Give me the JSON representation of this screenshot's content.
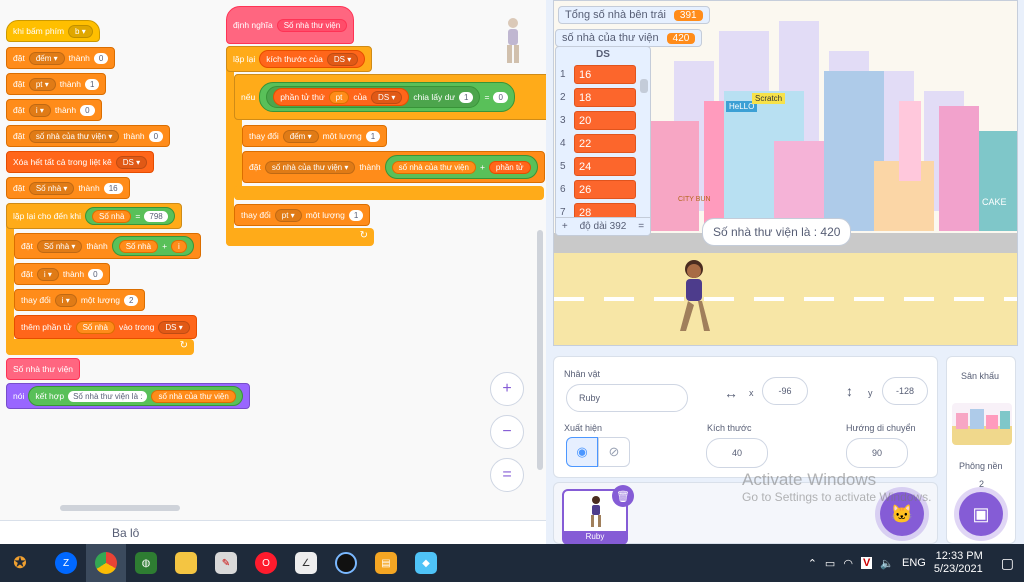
{
  "script_left": {
    "when_key": "khi bấm phím",
    "when_key_val": "b",
    "set1_label": "đặt",
    "set1_var": "đếm",
    "set1_to": "thành",
    "set1_val": "0",
    "set2_label": "đặt",
    "set2_var": "pt",
    "set2_to": "thành",
    "set2_val": "1",
    "set3_label": "đặt",
    "set3_var": "i",
    "set3_to": "thành",
    "set3_val": "0",
    "set4_label": "đặt",
    "set4_var": "số nhà của thư viện",
    "set4_to": "thành",
    "set4_val": "0",
    "clear_label": "Xóa hết tất cả trong liệt kê",
    "clear_list": "DS",
    "set5_label": "đặt",
    "set5_var": "Số nhà",
    "set5_to": "thành",
    "set5_val": "16",
    "repeat_label": "lặp lại cho đến khi",
    "repeat_var": "Số nhà",
    "repeat_op": "=",
    "repeat_val": "798",
    "set6_label": "đặt",
    "set6_var": "Số nhà",
    "set6_to": "thành",
    "set6_rep": "Số nhà",
    "set6_plus": "+",
    "set6_rep2": "i",
    "set7_label": "đặt",
    "set7_var": "i",
    "set7_to": "thành",
    "set7_val": "0",
    "change_label": "thay đổi",
    "change_var": "i",
    "change_by": "một lượng",
    "change_val": "2",
    "add_label": "thêm phần tử",
    "add_rep": "Số nhà",
    "add_into": "vào trong",
    "add_list": "DS",
    "call_label": "Số nhà thư viện",
    "say_label": "nói",
    "join_label": "kết hợp",
    "join_txt": "Số nhà thư viện là  :",
    "join_rep": "số nhà của thư viện"
  },
  "script_right": {
    "define_label": "định nghĩa",
    "define_name": "Số nhà thư viện",
    "repeat_label": "lặp lại",
    "repeat_op": "kích thước của",
    "repeat_list": "DS",
    "if_label": "nếu",
    "if_item": "phần tử thứ",
    "if_rep": "pt",
    "if_of": "của",
    "if_list": "DS",
    "if_mod": "chia lấy dư",
    "if_modval": "1",
    "if_eq": "=",
    "if_val": "0",
    "change1_label": "thay đổi",
    "change1_var": "đếm",
    "change1_by": "một lượng",
    "change1_val": "1",
    "set_label": "đặt",
    "set_var": "số nhà của thư viện",
    "set_to": "thành",
    "set_rep": "số nhà của thư viện",
    "set_plus": "+",
    "set_item": "phần tử",
    "change2_label": "thay đổi",
    "change2_var": "pt",
    "change2_by": "một lượng",
    "change2_val": "1"
  },
  "zoom": {
    "in": "+",
    "out": "−",
    "reset": "="
  },
  "backpack": {
    "label": "Ba lô"
  },
  "stage": {
    "monitor1_label": "Tổng số nhà bên trái",
    "monitor1_val": "391",
    "monitor2_label": "số nhà của thư viện",
    "monitor2_val": "420",
    "list_title": "DS",
    "list_items": [
      "16",
      "18",
      "20",
      "22",
      "24",
      "26",
      "28"
    ],
    "list_len": "độ dài 392",
    "list_eq": "=",
    "speech": "Số nhà thư viện là  : 420",
    "sign_hello": "HeLLO",
    "sign_scratch": "Scratch",
    "sign_city": "CITY BUN",
    "sign_cake": "CAKE"
  },
  "sprite_info": {
    "sprite_label": "Nhân vật",
    "sprite_name": "Ruby",
    "x_label": "x",
    "x_val": "-96",
    "y_label": "y",
    "y_val": "-128",
    "show_label": "Xuất hiện",
    "size_label": "Kích thước",
    "size_val": "40",
    "dir_label": "Hướng di chuyển",
    "dir_val": "90",
    "sprite_thumb_name": "Ruby"
  },
  "stage_panel": {
    "label": "Sân khấu",
    "backdrops_label": "Phông nền",
    "backdrops_count": "2"
  },
  "watermark": {
    "line1": "Activate Windows",
    "line2": "Go to Settings to activate Windows."
  },
  "taskbar": {
    "lang": "ENG",
    "time": "12:33 PM",
    "date": "5/23/2021"
  }
}
